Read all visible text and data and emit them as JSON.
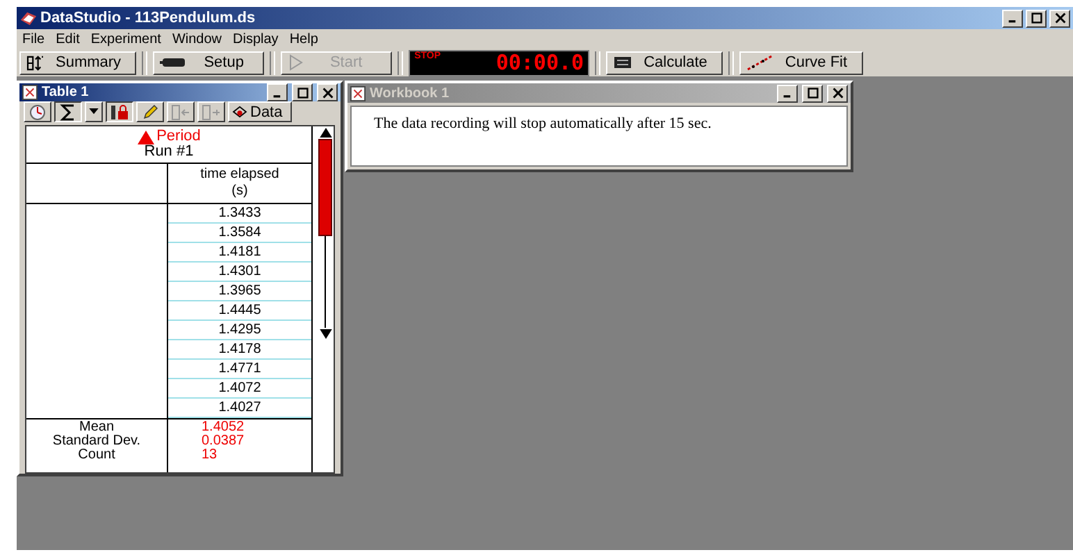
{
  "window": {
    "title": "DataStudio - 113Pendulum.ds"
  },
  "menu": [
    "File",
    "Edit",
    "Experiment",
    "Window",
    "Display",
    "Help"
  ],
  "toolbar": [
    {
      "kind": "summary",
      "label": "Summary",
      "disabled": false
    },
    {
      "kind": "setup",
      "label": "Setup",
      "disabled": false
    },
    {
      "kind": "start",
      "label": "Start",
      "disabled": true
    },
    {
      "kind": "clock",
      "label": "STOP",
      "value": "00:00.0"
    },
    {
      "kind": "calculate",
      "label": "Calculate",
      "disabled": false
    },
    {
      "kind": "curvefit",
      "label": "Curve Fit",
      "disabled": false
    }
  ],
  "table_window": {
    "title": "Table 1",
    "data_button": "Data",
    "measurement": "Period",
    "run": "Run #1",
    "column": [
      "time elapsed",
      "(s)"
    ],
    "rows": [
      "1.3433",
      "1.3584",
      "1.4181",
      "1.4301",
      "1.3965",
      "1.4445",
      "1.4295",
      "1.4178",
      "1.4771",
      "1.4072",
      "1.4027"
    ],
    "stats": [
      {
        "label": "Mean",
        "value": "1.4052"
      },
      {
        "label": "Standard Dev.",
        "value": "0.0387"
      },
      {
        "label": "Count",
        "value": "13"
      }
    ]
  },
  "workbook": {
    "title": "Workbook 1",
    "text": "The data recording will stop automatically after 15 sec."
  }
}
